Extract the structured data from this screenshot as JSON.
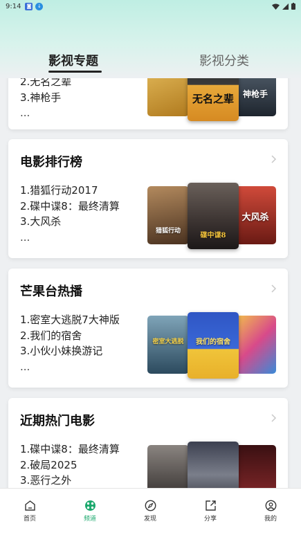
{
  "status_bar": {
    "time": "9:14"
  },
  "tabs": [
    {
      "label": "影视专题",
      "active": true
    },
    {
      "label": "影视分类",
      "active": false
    }
  ],
  "cards": [
    {
      "title": "",
      "items": [
        "2.无名之辈",
        "3.神枪手",
        "..."
      ],
      "posters": [
        {
          "caption": "",
          "color": "#c79a2c"
        },
        {
          "caption": "无名之辈",
          "color": "#e2a93a"
        },
        {
          "caption": "神枪手",
          "color": "#2f3b48"
        }
      ]
    },
    {
      "title": "电影排行榜",
      "items": [
        "1.猎狐行动2017",
        "2.碟中谍8：最终清算",
        "3.大风杀",
        "..."
      ],
      "posters": [
        {
          "caption": "猎狐行动",
          "color": "#7a5a3c"
        },
        {
          "caption": "碟中谍8",
          "color": "#3a3230"
        },
        {
          "caption": "大风杀",
          "color": "#b23a2e"
        }
      ]
    },
    {
      "title": "芒果台热播",
      "items": [
        "1.密室大逃脱7大神版",
        "2.我们的宿舍",
        "3.小伙小妹换游记",
        "..."
      ],
      "posters": [
        {
          "caption": "密室大逃脱",
          "color": "#3e6a84"
        },
        {
          "caption": "我们的宿舍",
          "color": "#2f56c4"
        },
        {
          "caption": "",
          "color": "#d9a53a"
        }
      ]
    },
    {
      "title": "近期热门电影",
      "items": [
        "1.碟中谍8：最终清算",
        "2.破局2025",
        "3.恶行之外"
      ],
      "posters": [
        {
          "caption": "",
          "color": "#4a4644"
        },
        {
          "caption": "",
          "color": "#5b5f6b"
        },
        {
          "caption": "",
          "color": "#6e1d20"
        }
      ]
    }
  ],
  "bottom_nav": [
    {
      "label": "首页",
      "icon": "home-icon",
      "active": false
    },
    {
      "label": "频道",
      "icon": "channel-icon",
      "active": true
    },
    {
      "label": "发现",
      "icon": "compass-icon",
      "active": false
    },
    {
      "label": "分享",
      "icon": "share-icon",
      "active": false
    },
    {
      "label": "我的",
      "icon": "user-icon",
      "active": false
    }
  ],
  "colors": {
    "accent": "#1aa86c",
    "header_tint": "#bfeee3"
  }
}
